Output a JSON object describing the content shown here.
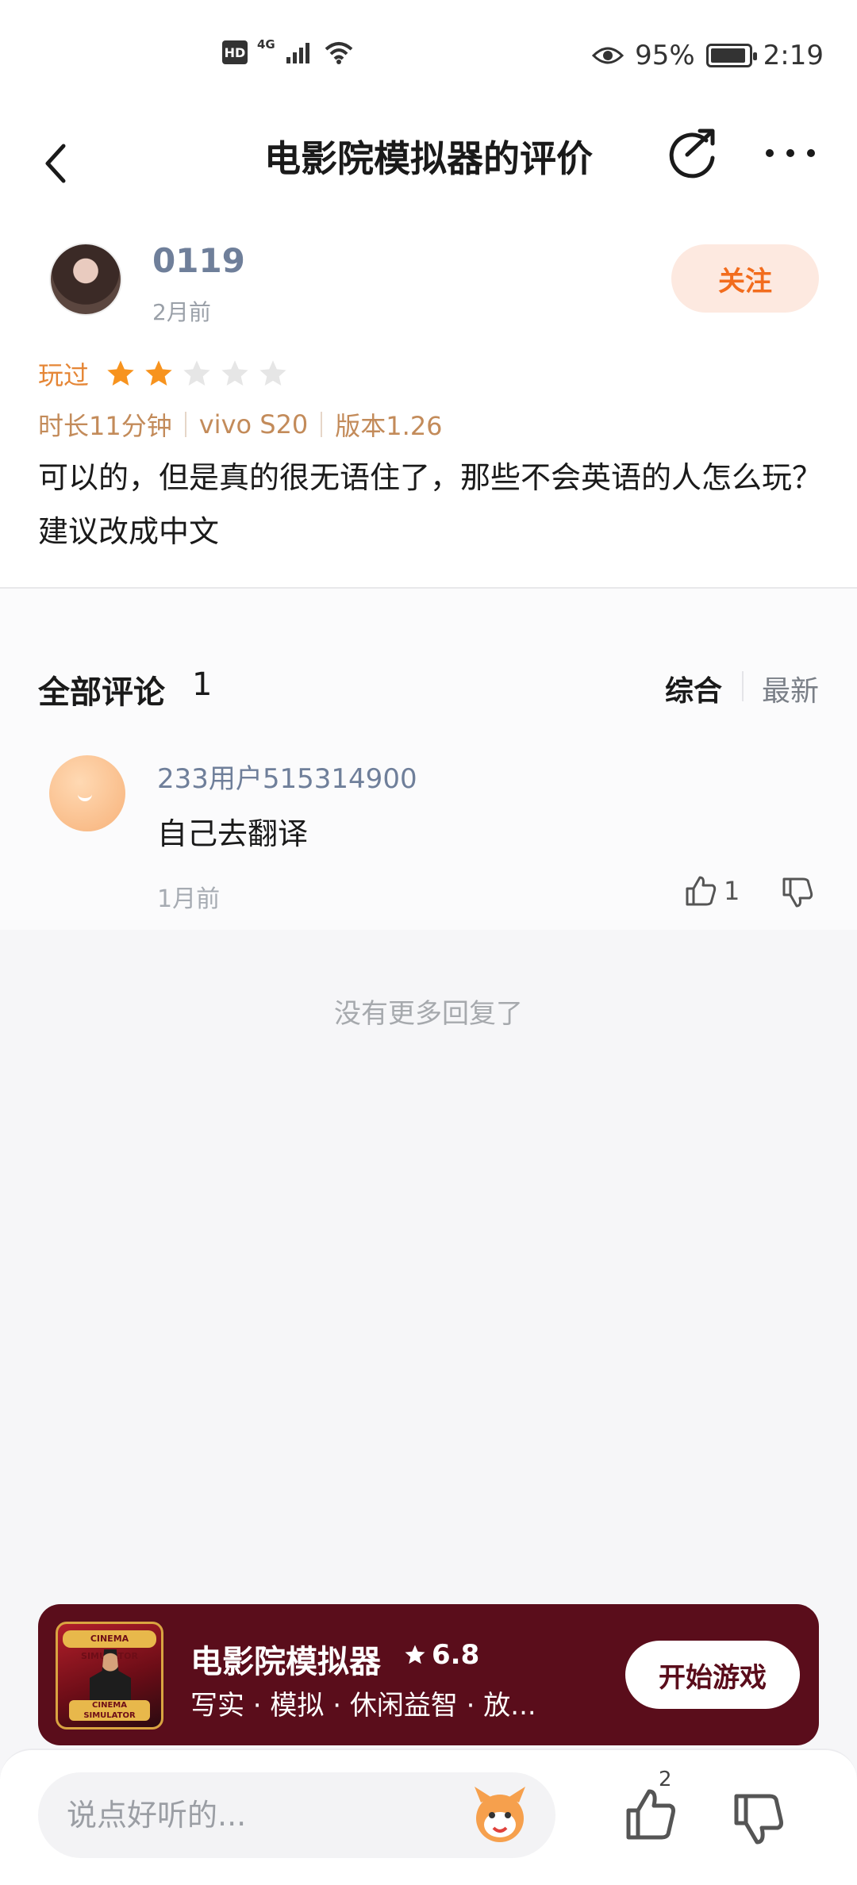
{
  "status_bar": {
    "hd": "HD",
    "network": "4G",
    "battery_pct": "95%",
    "time": "2:19"
  },
  "nav": {
    "title": "电影院模拟器的评价"
  },
  "review": {
    "username": "0119",
    "time": "2月前",
    "follow_label": "关注",
    "played_label": "玩过",
    "rating": 2,
    "rating_max": 5,
    "meta": [
      "时长11分钟",
      "vivo S20",
      "版本1.26"
    ],
    "text": "可以的，但是真的很无语住了，那些不会英语的人怎么玩？建议改成中文"
  },
  "comments": {
    "title": "全部评论",
    "count": "1",
    "sort_options": [
      "综合",
      "最新"
    ],
    "items": [
      {
        "user": "233用户515314900",
        "text": "自己去翻译",
        "time": "1月前",
        "likes": "1"
      }
    ],
    "no_more": "没有更多回复了"
  },
  "game_card": {
    "name": "电影院模拟器",
    "rating": "6.8",
    "tags": "写实 · 模拟 · 休闲益智 · 放...",
    "start_label": "开始游戏",
    "icon_top_text": "CINEMA SIMULATOR",
    "icon_bottom_text": "CINEMA SIMULATOR",
    "bg_color": "#5a0d1b"
  },
  "bottom_bar": {
    "input_placeholder": "说点好听的...",
    "like_count": "2"
  },
  "colors": {
    "accent_orange": "#f26c1d",
    "star_active": "#f7931e",
    "star_inactive": "#e6e6e6",
    "username_color": "#6f7f9a"
  }
}
